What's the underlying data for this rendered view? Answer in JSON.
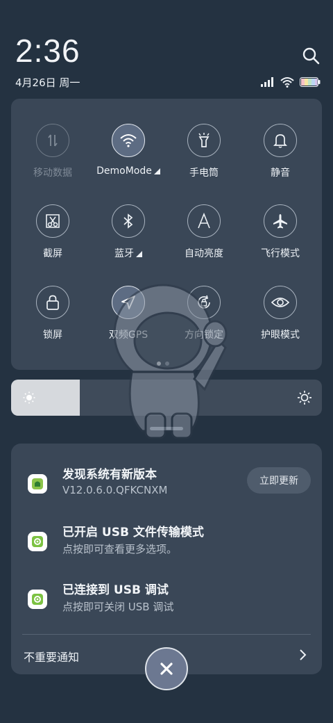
{
  "status": {
    "time": "2:36",
    "date": "4月26日 周一"
  },
  "quick_settings": {
    "tiles": [
      {
        "id": "mobile-data",
        "label": "移动数据",
        "state": "disabled",
        "icon": "mobile-data-icon"
      },
      {
        "id": "wifi",
        "label": "DemoMode",
        "state": "on",
        "icon": "wifi-icon",
        "has_arrow": true
      },
      {
        "id": "flashlight",
        "label": "手电筒",
        "state": "off",
        "icon": "flashlight-icon"
      },
      {
        "id": "silent",
        "label": "静音",
        "state": "off",
        "icon": "bell-icon"
      },
      {
        "id": "screenshot",
        "label": "截屏",
        "state": "off",
        "icon": "screenshot-icon"
      },
      {
        "id": "bluetooth",
        "label": "蓝牙",
        "state": "off",
        "icon": "bluetooth-icon",
        "has_arrow": true
      },
      {
        "id": "auto-brightness",
        "label": "自动亮度",
        "state": "off",
        "icon": "auto-brightness-icon"
      },
      {
        "id": "airplane",
        "label": "飞行模式",
        "state": "off",
        "icon": "airplane-icon"
      },
      {
        "id": "lock-screen",
        "label": "锁屏",
        "state": "off",
        "icon": "lock-icon"
      },
      {
        "id": "dual-gps",
        "label": "双频GPS",
        "state": "on",
        "icon": "location-icon"
      },
      {
        "id": "rotation-lock",
        "label": "方向锁定",
        "state": "off",
        "icon": "rotation-lock-icon"
      },
      {
        "id": "eye-care",
        "label": "护眼模式",
        "state": "off",
        "icon": "eye-icon"
      }
    ],
    "page_count": 2,
    "current_page": 1
  },
  "brightness": {
    "level": 0.22
  },
  "notifications": [
    {
      "title": "发现系统有新版本",
      "subtitle": "V12.0.6.0.QFKCNXM",
      "action_label": "立即更新",
      "icon": "android-update-icon"
    },
    {
      "title": "已开启 USB 文件传输模式",
      "subtitle": "点按即可查看更多选项。",
      "icon": "settings-gear-icon"
    },
    {
      "title": "已连接到 USB 调试",
      "subtitle": "点按即可关闭 USB 调试",
      "icon": "settings-gear-icon"
    }
  ],
  "minor_notifications": {
    "label": "不重要通知"
  },
  "colors": {
    "background": "#243241",
    "panel": "#3a4757",
    "accent_on": "#5d6c83",
    "app_icon_green": "#7cc242"
  }
}
